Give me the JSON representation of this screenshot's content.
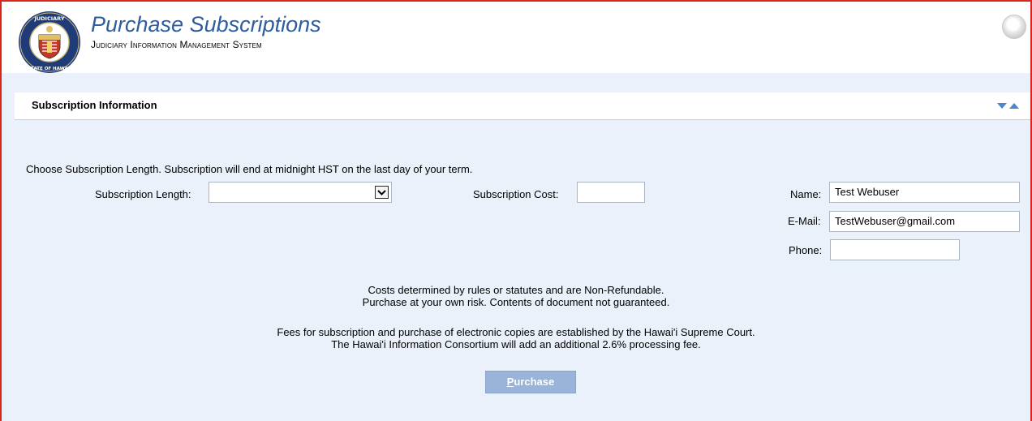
{
  "header": {
    "title": "Purchase Subscriptions",
    "subtitle": "Judiciary Information Management System",
    "seal_top_text": "JUDICIARY",
    "seal_bottom_text": "STATE OF HAWAII"
  },
  "section": {
    "title": "Subscription Information"
  },
  "form": {
    "instruction": "Choose Subscription Length. Subscription will end at midnight HST on the last day of your term.",
    "length_label": "Subscription Length:",
    "length_value": "",
    "cost_label": "Subscription Cost:",
    "cost_value": "",
    "name_label": "Name:",
    "name_value": "Test Webuser",
    "email_label": "E-Mail:",
    "email_value": "TestWebuser@gmail.com",
    "phone_label": "Phone:",
    "phone_value": ""
  },
  "notices": {
    "line1": "Costs determined by rules or statutes and are Non-Refundable.",
    "line2": "Purchase at your own risk. Contents of document not guaranteed.",
    "line3": "Fees for subscription and purchase of electronic copies are established by the Hawai'i Supreme Court.",
    "line4": "The Hawai'i Information Consortium will add an additional 2.6% processing fee."
  },
  "actions": {
    "purchase_accesskey": "P",
    "purchase_rest": "urchase"
  },
  "colors": {
    "frame_border": "#d9251c",
    "title_blue": "#2e5d9f",
    "panel_bg": "#eaf1fa",
    "button_bg": "#9ab3d8",
    "arrow_blue": "#4a86c8"
  },
  "icons": {
    "seal": "judiciary-seal-icon",
    "status": "status-orb-icon",
    "collapse": "collapse-expand-arrows-icon",
    "dropdown": "chevron-down-icon"
  }
}
